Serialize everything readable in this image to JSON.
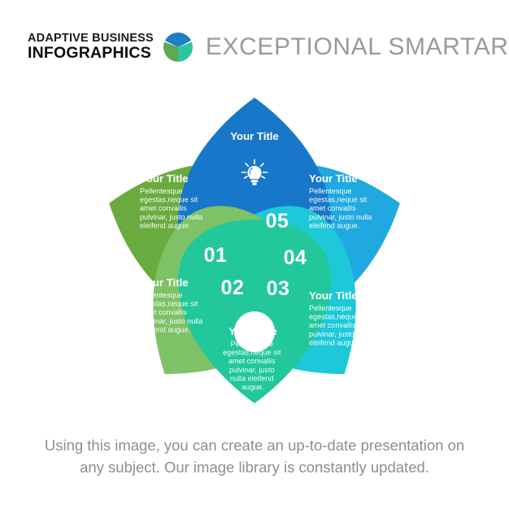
{
  "header": {
    "brand_line1": "ADAPTIVE BUSINESS",
    "brand_line2": "INFOGRAPHICS",
    "title": "EXCEPTIONAL SMARTART",
    "logo_icon": "pie-circle-logo-icon",
    "logo_colors": {
      "top": "#1f7ec4",
      "left": "#5fa857",
      "right": "#2ec4a0"
    },
    "title_color": "#9a9a9a"
  },
  "diagram": {
    "type": "petal-venn-infographic",
    "center_hub": "white-circle-hub",
    "body_text": "Pellentesque egestas,neque sit amet convallis pulvinar, justo nulla eleifend augue.",
    "petals": [
      {
        "id": "petal-01",
        "number": "01",
        "title": "Your Title",
        "body": "Pellentesque egestas,neque sit amet convallis pulvinar, justo nulla eleifend augue.",
        "color": "#6aab3f",
        "icon": null
      },
      {
        "id": "petal-02",
        "number": "02",
        "title": "Your Title",
        "body": "Pellentesque egestas,neque sit amet convallis pulvinar, justo nulla eleifend augue.",
        "color": "#7dc267",
        "icon": null
      },
      {
        "id": "petal-03",
        "number": "03",
        "title": "Your Title",
        "body": "Pellentesque egestas,neque sit amet convallis pulvinar, justo nulla eleifend augue.",
        "color": "#22c79b",
        "icon": null
      },
      {
        "id": "petal-04",
        "number": "04",
        "title": "Your Title",
        "body": "Pellentesque egestas,neque sit amet convallis pulvinar, justo nulla eleifend augue.",
        "color": "#1dc8d8",
        "icon": null
      },
      {
        "id": "petal-05",
        "number": "05",
        "title": "Your Title",
        "body": "Pellentesque egestas,neque sit amet convallis pulvinar, justo nulla eleifend augue.",
        "color": "#20a9e0",
        "icon": null
      },
      {
        "id": "petal-top",
        "number": "",
        "title": "Your Title",
        "body": "",
        "color": "#1877c8",
        "icon": "lightbulb-icon"
      }
    ]
  },
  "caption": {
    "line1": "Using this image, you can create an up-to-date presentation on",
    "line2": "any subject. Our image library is constantly updated."
  }
}
